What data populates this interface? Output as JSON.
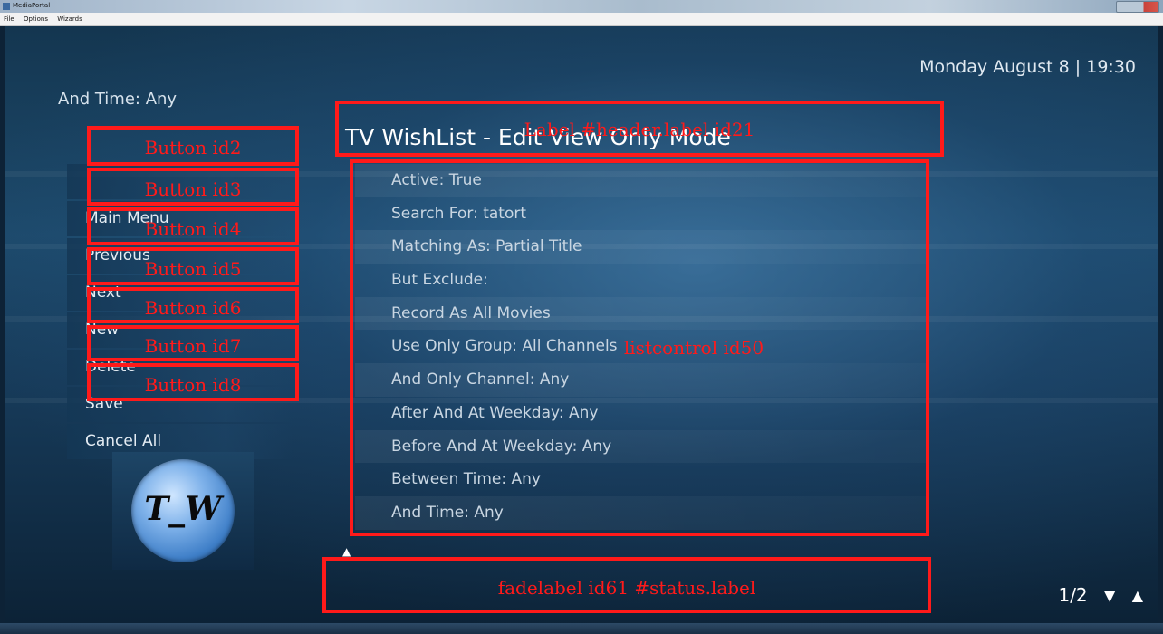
{
  "window": {
    "title": "MediaPortal",
    "menu": [
      "File",
      "Options",
      "Wizards"
    ]
  },
  "clock": "Monday August 8 | 19:30",
  "hint": "And Time: Any",
  "header": "TV WishList - Edit  View Only Mode",
  "menu": [
    {
      "label": ""
    },
    {
      "label": "Main Menu"
    },
    {
      "label": "Previous"
    },
    {
      "label": "Next"
    },
    {
      "label": "New"
    },
    {
      "label": "Delete"
    },
    {
      "label": "Save"
    },
    {
      "label": "Cancel All"
    }
  ],
  "list": [
    "Active: True",
    "Search For: tatort",
    "Matching As: Partial Title",
    "But Exclude:",
    "Record As All Movies",
    "Use Only Group: All Channels",
    "And Only Channel: Any",
    "After And At Weekday: Any",
    "Before And At Weekday: Any",
    "Between Time: Any",
    "And Time: Any"
  ],
  "logo": "T_W",
  "pager": {
    "page": "1/2",
    "down": "▼",
    "up": "▲"
  },
  "overlays": {
    "header": "Label #header.label id21",
    "list": "listcontrol id50",
    "status": "fadelabel id61 #status.label",
    "buttons": [
      "Button id2",
      "Button id3",
      "Button id4",
      "Button id5",
      "Button id6",
      "Button id7",
      "Button id8"
    ]
  }
}
